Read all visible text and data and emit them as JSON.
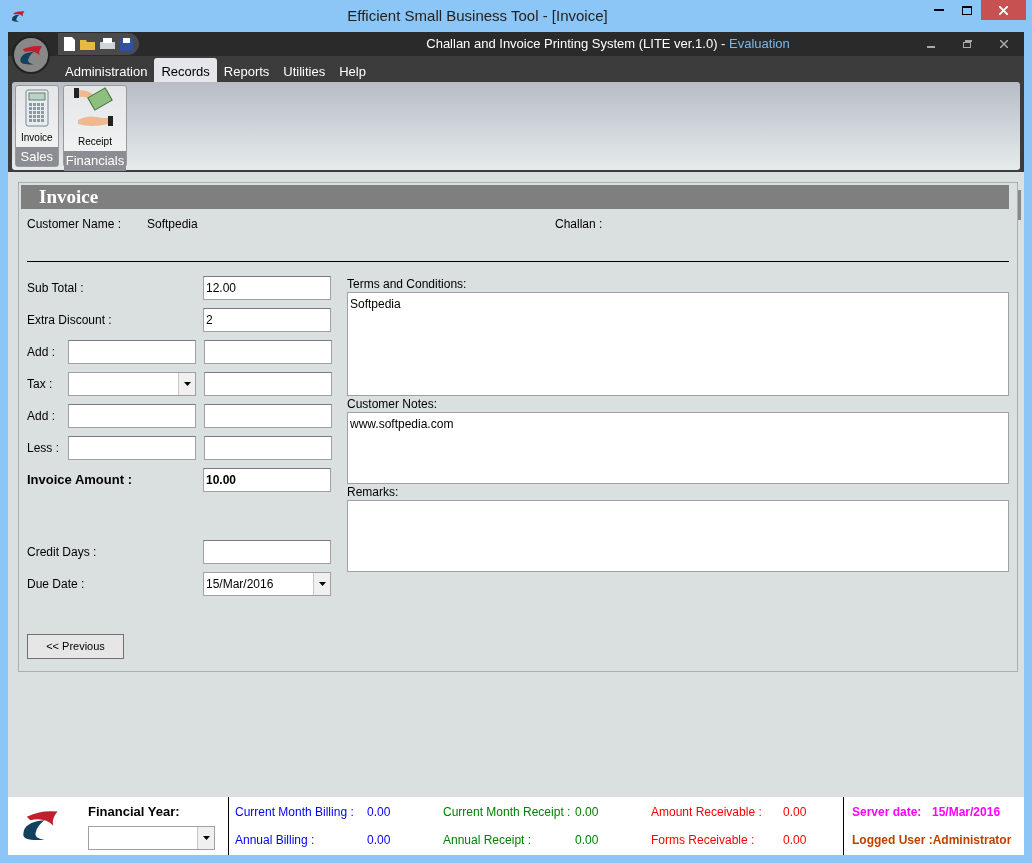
{
  "window": {
    "title": "Efficient Small Business Tool - [Invoice]"
  },
  "app": {
    "title": "Challan and Invoice Printing System (LITE ver.1.0) - ",
    "edition": "Evaluation"
  },
  "menu": [
    {
      "label": "Administration",
      "selected": false
    },
    {
      "label": "Records",
      "selected": true
    },
    {
      "label": "Reports",
      "selected": false
    },
    {
      "label": "Utilities",
      "selected": false
    },
    {
      "label": "Help",
      "selected": false
    }
  ],
  "ribbon": [
    {
      "label": "Sales",
      "button": "Invoice",
      "kind": "calculator"
    },
    {
      "label": "Financials",
      "button": "Receipt",
      "kind": "money"
    }
  ],
  "form": {
    "heading": "Invoice",
    "customer_label": "Customer Name :",
    "customer_value": "Softpedia",
    "challan_label": "Challan :",
    "rows": [
      {
        "kind": "single",
        "label": "Sub Total :",
        "value": "12.00"
      },
      {
        "kind": "single",
        "label": "Extra Discount :",
        "value": "2"
      },
      {
        "kind": "double",
        "label": "Add :"
      },
      {
        "kind": "combo",
        "label": "Tax :"
      },
      {
        "kind": "double",
        "label": "Add :"
      },
      {
        "kind": "double",
        "label": "Less :"
      },
      {
        "kind": "total",
        "label": "Invoice Amount :",
        "value": "10.00"
      },
      {
        "kind": "single",
        "label": "Credit Days :"
      },
      {
        "kind": "date",
        "label": "Due Date :",
        "value": "15/Mar/2016"
      }
    ],
    "notes": [
      {
        "label": "Terms and Conditions:",
        "value": "Softpedia"
      },
      {
        "label": "Customer Notes:",
        "value": "www.softpedia.com"
      },
      {
        "label": "Remarks:"
      }
    ],
    "previous_button": "<< Previous"
  },
  "status": {
    "financial_year_label": "Financial Year:",
    "columns": [
      [
        {
          "label": "Current Month Billing :",
          "value": "0.00",
          "color": "#0000ff"
        },
        {
          "label": "Annual Billing :",
          "value": "0.00",
          "color": "#0000ff"
        }
      ],
      [
        {
          "label": "Current Month Receipt :",
          "value": "0.00",
          "color": "#008000"
        },
        {
          "label": "Annual Receipt :",
          "value": "0.00",
          "color": "#008000"
        }
      ],
      [
        {
          "label": "Amount Receivable :",
          "value": "0.00",
          "color": "#ff0000"
        },
        {
          "label": "Forms Receivable :",
          "value": "0.00",
          "color": "#ff0000"
        }
      ]
    ],
    "server_date_label": "Server date:",
    "server_date": "15/Mar/2016",
    "logged_user": "Logged User :Administrator"
  }
}
